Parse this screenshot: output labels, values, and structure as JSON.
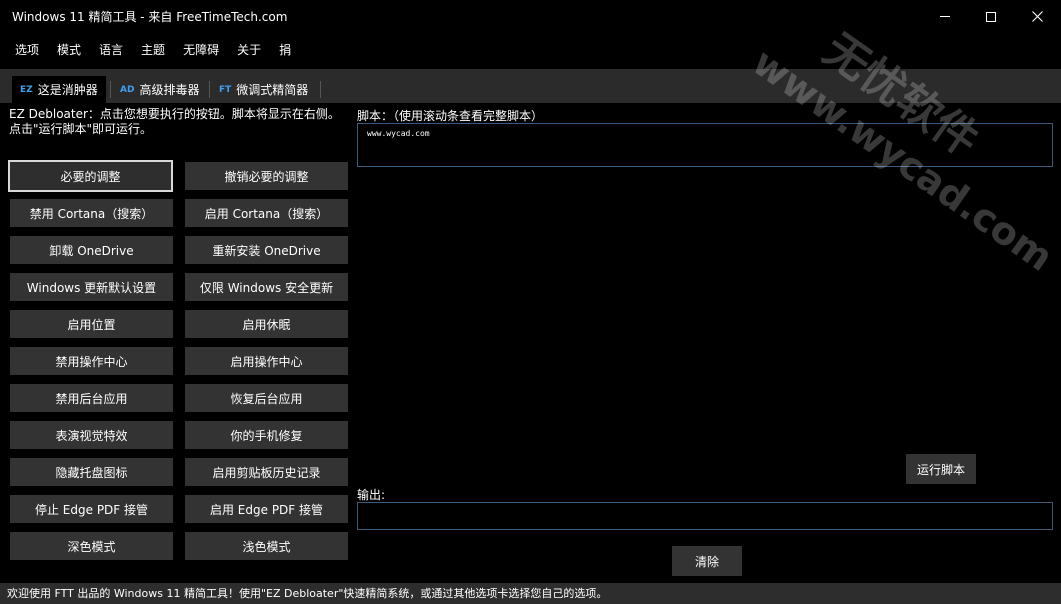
{
  "window": {
    "title": "Windows 11 精简工具 - 来自 FreeTimeTech.com"
  },
  "menu": [
    "选项",
    "模式",
    "语言",
    "主题",
    "无障碍",
    "关于",
    "捐"
  ],
  "tabs": [
    {
      "code": "EZ",
      "label": "这是消肿器"
    },
    {
      "code": "AD",
      "label": "高级排毒器"
    },
    {
      "code": "FT",
      "label": "微调式精简器"
    }
  ],
  "description": {
    "line1": "EZ Debloater：点击您想要执行的按钮。脚本将显示在右侧。",
    "line2": "点击\"运行脚本\"即可运行。"
  },
  "buttons": {
    "left": [
      "必要的调整",
      "禁用 Cortana（搜索）",
      "卸载 OneDrive",
      "Windows 更新默认设置",
      "启用位置",
      "禁用操作中心",
      "禁用后台应用",
      "表演视觉特效",
      "隐藏托盘图标",
      "停止 Edge PDF 接管",
      "深色模式"
    ],
    "right": [
      "撤销必要的调整",
      "启用 Cortana（搜索）",
      "重新安装 OneDrive",
      "仅限 Windows 安全更新",
      "启用休眠",
      "启用操作中心",
      "恢复后台应用",
      "你的手机修复",
      "启用剪贴板历史记录",
      "启用 Edge PDF 接管",
      "浅色模式"
    ]
  },
  "script": {
    "label": "脚本：（使用滚动条查看完整脚本）",
    "content": "www.wycad.com"
  },
  "run_button": "运行脚本",
  "output_label": "输出:",
  "clear_button": "清除",
  "status": "欢迎使用 FTT 出品的 Windows 11 精简工具！使用\"EZ Debloater\"快速精简系统，或通过其他选项卡选择您自己的选项。",
  "watermark": {
    "line1": "www.wycad.com",
    "line2": "无忧软件"
  }
}
